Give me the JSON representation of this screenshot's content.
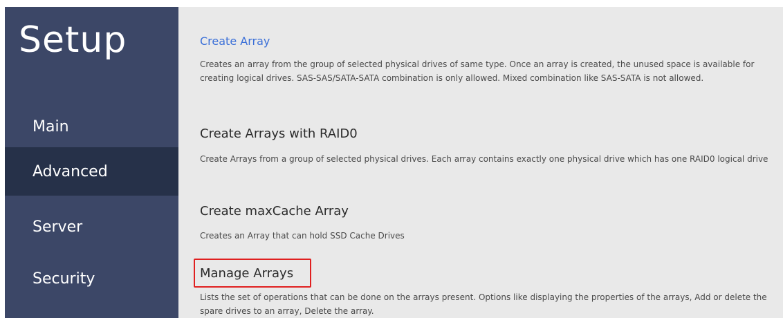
{
  "header": {
    "title": "Setup"
  },
  "sidebar": {
    "items": [
      {
        "label": "Main"
      },
      {
        "label": "Advanced"
      },
      {
        "label": "Server"
      },
      {
        "label": "Security"
      }
    ]
  },
  "main": {
    "entries": [
      {
        "title": "Create Array",
        "description": "Creates an array from the group of selected physical drives of same type. Once an array is created, the unused space is available for creating logical drives. SAS-SAS/SATA-SATA combination is only allowed. Mixed combination like SAS-SATA is not allowed."
      },
      {
        "title": "Create Arrays with RAID0",
        "description": "Create Arrays from a group of selected physical drives. Each array contains exactly one physical drive which has one RAID0 logical drive"
      },
      {
        "title": "Create maxCache Array",
        "description": "Creates an Array that can hold SSD Cache Drives"
      },
      {
        "title": "Manage Arrays",
        "description": "Lists the set of operations that can be done on the arrays present. Options like displaying the properties of the arrays, Add or delete the spare drives to an array, Delete the array."
      }
    ]
  },
  "colors": {
    "sidebar_bg": "#3c4767",
    "sidebar_active_bg": "#263149",
    "content_bg": "#e9e9e9",
    "link": "#3a6fd8",
    "highlight": "#e02020"
  }
}
